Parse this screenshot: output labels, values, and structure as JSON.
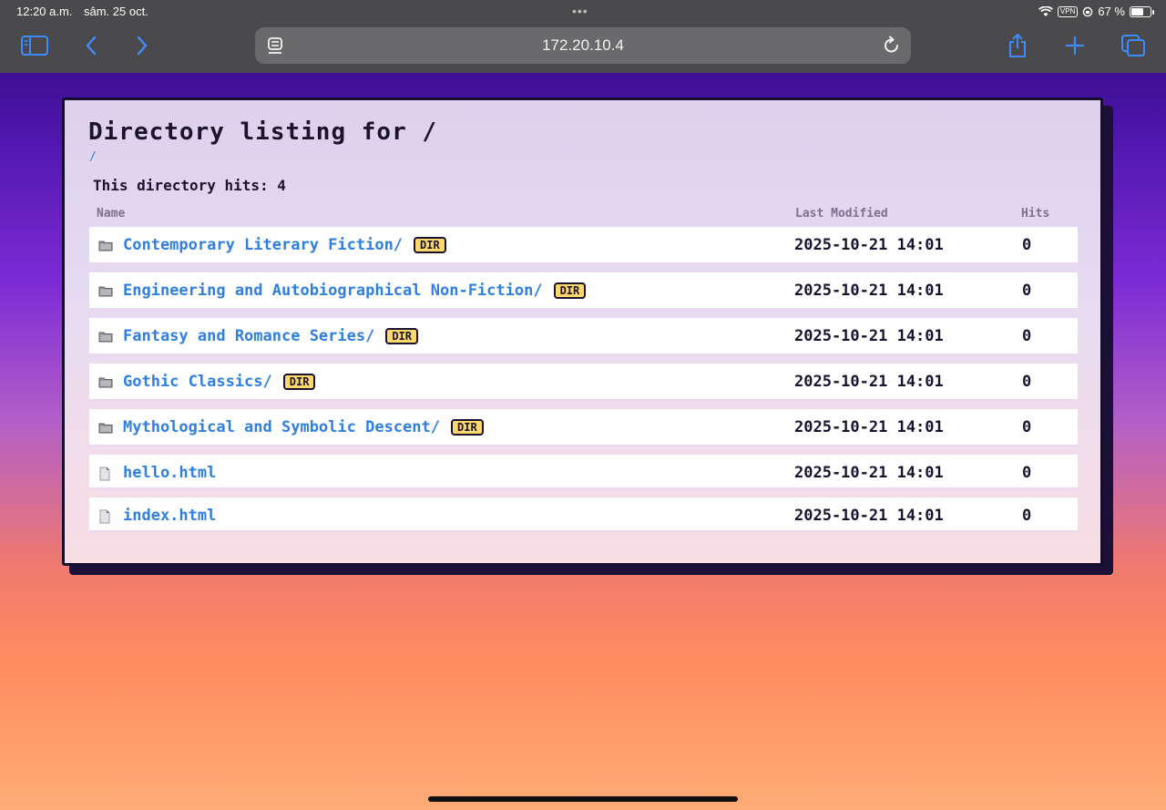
{
  "status_bar": {
    "time": "12:20 a.m.",
    "date": "sâm. 25 oct.",
    "vpn": "VPN",
    "battery": "67 %",
    "battery_level": 0.67
  },
  "browser": {
    "url": "172.20.10.4"
  },
  "page": {
    "title": "Directory listing for /",
    "breadcrumb": "/",
    "hits_line": "This directory hits: 4",
    "columns": {
      "name": "Name",
      "modified": "Last Modified",
      "hits": "Hits"
    },
    "dir_badge": "DIR",
    "entries": [
      {
        "name": "Contemporary Literary Fiction/",
        "type": "dir",
        "modified": "2025-10-21 14:01",
        "hits": "0"
      },
      {
        "name": "Engineering and Autobiographical Non-Fiction/",
        "type": "dir",
        "modified": "2025-10-21 14:01",
        "hits": "0"
      },
      {
        "name": "Fantasy and Romance Series/",
        "type": "dir",
        "modified": "2025-10-21 14:01",
        "hits": "0"
      },
      {
        "name": "Gothic Classics/",
        "type": "dir",
        "modified": "2025-10-21 14:01",
        "hits": "0"
      },
      {
        "name": "Mythological and Symbolic Descent/",
        "type": "dir",
        "modified": "2025-10-21 14:01",
        "hits": "0"
      },
      {
        "name": "hello.html",
        "type": "file",
        "modified": "2025-10-21 14:01",
        "hits": "0"
      },
      {
        "name": "index.html",
        "type": "file",
        "modified": "2025-10-21 14:01",
        "hits": "0"
      }
    ]
  },
  "icons": {
    "dir": "folder-icon",
    "file": "file-icon"
  },
  "colors": {
    "link": "#2f7fe0",
    "badge": "#ffd86a",
    "accent": "#3d8bff"
  }
}
